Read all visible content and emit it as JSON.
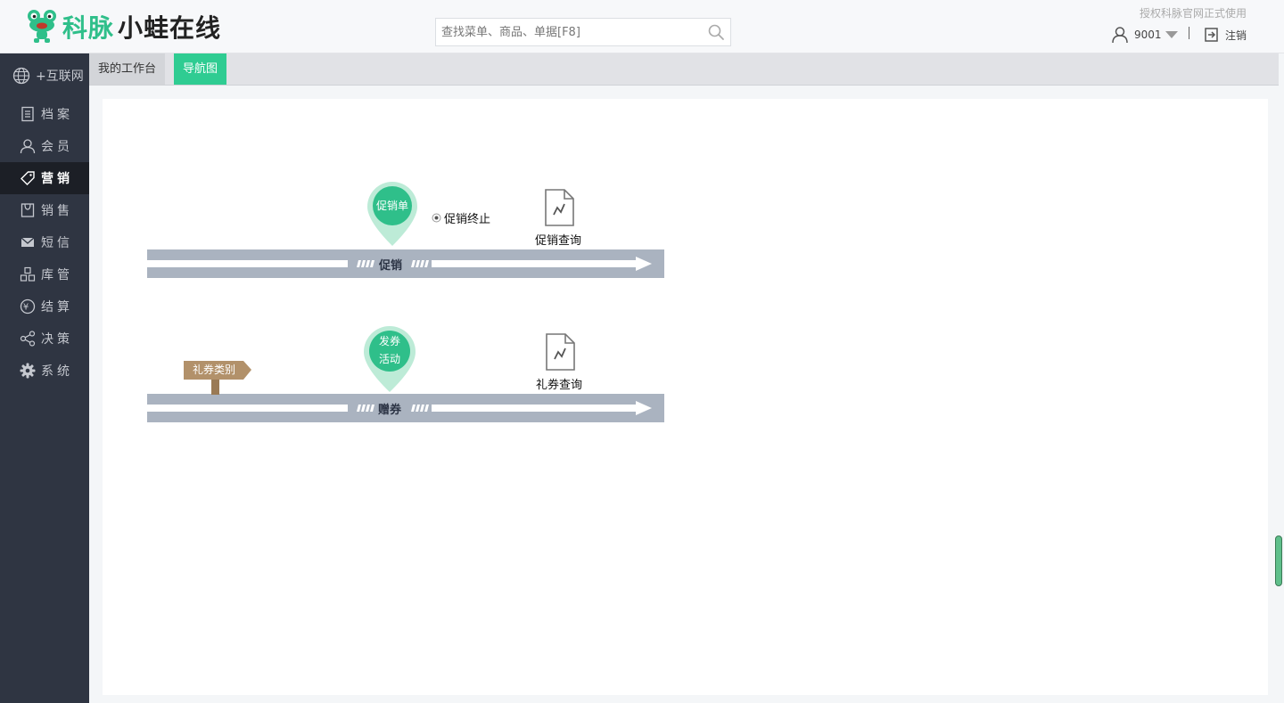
{
  "header": {
    "brand": "科脉",
    "brand_sub": "小蛙在线",
    "search_placeholder": "查找菜单、商品、单据[F8]",
    "license": "授权科脉官网正式使用",
    "user": "9001",
    "logout": "注销"
  },
  "sidebar": {
    "items": [
      {
        "label": "+互联网",
        "icon": "globe-icon"
      },
      {
        "label": "档案",
        "icon": "document-icon"
      },
      {
        "label": "会员",
        "icon": "user-icon"
      },
      {
        "label": "营销",
        "icon": "tag-icon",
        "active": true
      },
      {
        "label": "销售",
        "icon": "bag-icon"
      },
      {
        "label": "短信",
        "icon": "mail-icon"
      },
      {
        "label": "库管",
        "icon": "boxes-icon"
      },
      {
        "label": "结算",
        "icon": "yen-icon"
      },
      {
        "label": "决策",
        "icon": "share-icon"
      },
      {
        "label": "系统",
        "icon": "gear-icon"
      }
    ]
  },
  "tabs": {
    "workbench": "我的工作台",
    "navmap": "导航图"
  },
  "navmap": {
    "lanes": [
      {
        "name": "促销",
        "pin_lines": [
          "促销单"
        ],
        "radio": "促销终止",
        "query": "促销查询"
      },
      {
        "name": "赠券",
        "pin_lines": [
          "发券",
          "活动"
        ],
        "signpost": "礼券类别",
        "query": "礼券查询"
      }
    ]
  },
  "colors": {
    "accent": "#2fcc92",
    "pin": "#2fbf8a",
    "pin_halo": "#bdebd7",
    "lane": "#aab3c0",
    "sidebar": "#2f3542",
    "signpost": "#b2916a"
  }
}
